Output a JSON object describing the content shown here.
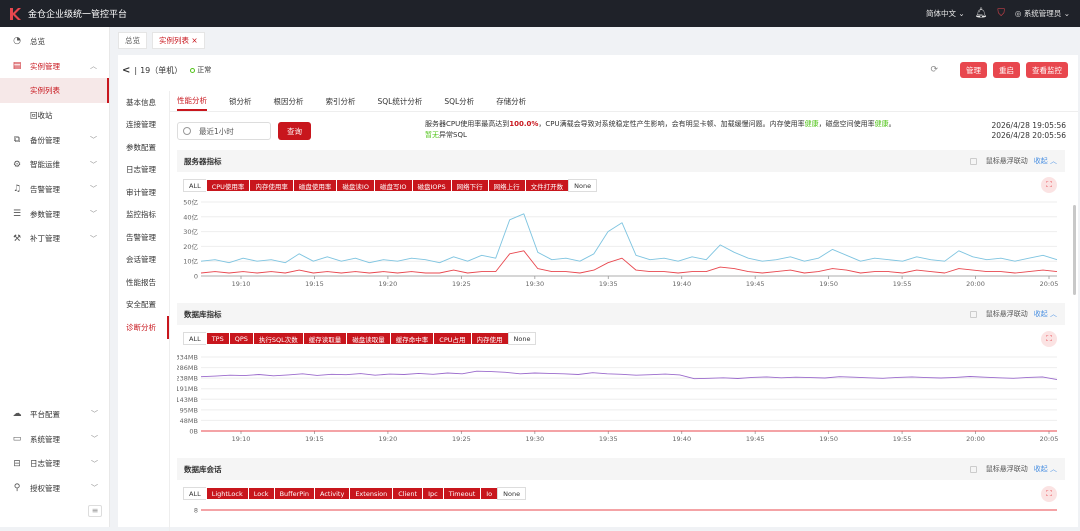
{
  "app": {
    "title": "金仓企业级统一管控平台",
    "lang": "简体中文",
    "user": "系统管理员"
  },
  "sidebar": {
    "items": [
      {
        "label": "总览",
        "icon": "dashboard-icon"
      },
      {
        "label": "实例管理",
        "icon": "instance-icon",
        "open": true,
        "sub": [
          {
            "label": "实例列表",
            "active": true
          },
          {
            "label": "回收站"
          }
        ]
      },
      {
        "label": "备份管理",
        "icon": "backup-icon"
      },
      {
        "label": "智能运维",
        "icon": "ops-icon"
      },
      {
        "label": "告警管理",
        "icon": "bell-icon"
      },
      {
        "label": "参数管理",
        "icon": "params-icon"
      },
      {
        "label": "补丁管理",
        "icon": "patch-icon"
      }
    ],
    "bottom": [
      {
        "label": "平台配置",
        "icon": "cloud-icon"
      },
      {
        "label": "系统管理",
        "icon": "monitor-icon"
      },
      {
        "label": "日志管理",
        "icon": "log-icon"
      },
      {
        "label": "授权管理",
        "icon": "license-icon"
      }
    ]
  },
  "page_tabs": [
    {
      "label": "总览"
    },
    {
      "label": "实例列表 ×",
      "active": true
    }
  ],
  "instance": {
    "name": "19（单机）",
    "status": "正常"
  },
  "actions": {
    "manage": "管理",
    "restart": "重启",
    "monitor": "查看监控"
  },
  "left_nav": [
    "基本信息",
    "连接管理",
    "参数配置",
    "日志管理",
    "审计管理",
    "监控指标",
    "告警管理",
    "会话管理",
    "性能报告",
    "安全配置",
    "诊断分析"
  ],
  "left_nav_active": 10,
  "sub_tabs": [
    "性能分析",
    "锁分析",
    "根因分析",
    "索引分析",
    "SQL统计分析",
    "SQL分析",
    "存储分析"
  ],
  "sub_tabs_active": 0,
  "filter": {
    "time_range": "最近1小时",
    "query": "查询"
  },
  "diagnosis": {
    "line1_a": "服务器CPU使用率最高达到",
    "line1_pct": "100.0%",
    "line1_b": "，CPU满载会导致对系统稳定性产生影响，会有明显卡顿、加载缓慢问题。内存使用率",
    "line1_mem": "健康",
    "line1_c": "，磁盘空间使用率",
    "line1_disk": "健康",
    "line1_d": "。",
    "line2_none": "暂无",
    "line2_b": "异常SQL"
  },
  "time_window": {
    "start": "2026/4/28 19:05:56",
    "end": "2026/4/28 20:05:56"
  },
  "panels": [
    {
      "title": "服务器指标",
      "sync": "鼠标悬浮联动",
      "fold": "收起",
      "legend": [
        "ALL",
        "CPU使用率",
        "内存使用率",
        "磁盘使用率",
        "磁盘读IO",
        "磁盘写IO",
        "磁盘IOPS",
        "网络下行",
        "网络上行",
        "文件打开数",
        "None"
      ],
      "legend_on": [
        1,
        2,
        3,
        4,
        5,
        6,
        7,
        8,
        9
      ]
    },
    {
      "title": "数据库指标",
      "sync": "鼠标悬浮联动",
      "fold": "收起",
      "legend": [
        "ALL",
        "TPS",
        "QPS",
        "执行SQL次数",
        "缓存读取量",
        "磁盘读取量",
        "缓存命中率",
        "CPU占用",
        "内存使用",
        "None"
      ],
      "legend_on": [
        1,
        2,
        3,
        4,
        5,
        6,
        7,
        8
      ]
    },
    {
      "title": "数据库会话",
      "sync": "鼠标悬浮联动",
      "fold": "收起",
      "legend": [
        "ALL",
        "LightLock",
        "Lock",
        "BufferPin",
        "Activity",
        "Extension",
        "Client",
        "Ipc",
        "Timeout",
        "Io",
        "None"
      ],
      "legend_on": [
        1,
        2,
        3,
        4,
        5,
        6,
        7,
        8,
        9
      ]
    }
  ],
  "chart_data": [
    {
      "type": "line",
      "x": [
        "19:10",
        "19:15",
        "19:20",
        "19:25",
        "19:30",
        "19:35",
        "19:40",
        "19:45",
        "19:50",
        "19:55",
        "20:00",
        "20:05"
      ],
      "ylim": [
        0,
        50
      ],
      "yticks": [
        "0",
        "10亿",
        "20亿",
        "30亿",
        "40亿",
        "50亿"
      ],
      "series": [
        {
          "color": "#7ec4e0",
          "values": [
            10,
            11,
            9,
            12,
            10,
            11,
            9,
            15,
            10,
            13,
            10,
            12,
            9,
            11,
            10,
            12,
            11,
            9,
            13,
            10,
            14,
            12,
            38,
            42,
            16,
            11,
            12,
            10,
            15,
            30,
            36,
            14,
            11,
            12,
            10,
            13,
            11,
            21,
            16,
            12,
            10,
            11,
            13,
            10,
            12,
            18,
            14,
            10,
            12,
            11,
            10,
            13,
            11,
            10,
            17,
            13,
            11,
            12,
            10,
            12,
            14,
            11
          ]
        },
        {
          "color": "#e8474e",
          "values": [
            2,
            3,
            2,
            3,
            2,
            3,
            2,
            4,
            2,
            3,
            2,
            3,
            2,
            3,
            2,
            3,
            2,
            2,
            4,
            2,
            3,
            3,
            15,
            17,
            5,
            3,
            3,
            2,
            4,
            9,
            12,
            4,
            3,
            3,
            2,
            3,
            3,
            6,
            5,
            3,
            2,
            3,
            4,
            2,
            3,
            5,
            4,
            2,
            3,
            3,
            2,
            4,
            3,
            2,
            5,
            4,
            3,
            3,
            2,
            3,
            4,
            3
          ]
        }
      ]
    },
    {
      "type": "line",
      "x": [
        "19:10",
        "19:15",
        "19:20",
        "19:25",
        "19:30",
        "19:35",
        "19:40",
        "19:45",
        "19:50",
        "19:55",
        "20:00",
        "20:05"
      ],
      "ylim": [
        0,
        334
      ],
      "yticks": [
        "0B",
        "48MB",
        "95MB",
        "143MB",
        "191MB",
        "238MB",
        "286MB",
        "334MB"
      ],
      "series": [
        {
          "color": "#9b6bcc",
          "values": [
            245,
            248,
            252,
            250,
            255,
            249,
            253,
            258,
            251,
            256,
            254,
            259,
            252,
            257,
            255,
            260,
            256,
            262,
            258,
            270,
            268,
            265,
            258,
            262,
            260,
            258,
            255,
            263,
            258,
            256,
            252,
            254,
            257,
            253,
            236,
            238,
            240,
            237,
            242,
            244,
            240,
            243,
            241,
            239,
            245,
            243,
            240,
            238,
            242,
            244,
            241,
            239,
            242,
            246,
            243,
            240,
            238,
            242,
            244,
            232
          ]
        },
        {
          "color": "#e8474e",
          "values": [
            0,
            0,
            0,
            0,
            0,
            0,
            0,
            0,
            0,
            0,
            0,
            0,
            0,
            0,
            0,
            0,
            0,
            0,
            0,
            0,
            0,
            0,
            0,
            0,
            0,
            0,
            0,
            0,
            0,
            0,
            0,
            0,
            0,
            0,
            0,
            0,
            0,
            0,
            0,
            0,
            0,
            0,
            0,
            0,
            0,
            0,
            0,
            0,
            0,
            0,
            0,
            0,
            0,
            0,
            0,
            0,
            0,
            0,
            0,
            0
          ]
        }
      ]
    },
    {
      "type": "line",
      "yticks": [
        "8"
      ],
      "ylim": [
        0,
        8
      ],
      "series": [
        {
          "color": "#e8474e",
          "values": [
            8,
            8,
            8,
            8,
            8,
            8,
            8,
            8,
            8,
            8
          ]
        }
      ]
    }
  ]
}
